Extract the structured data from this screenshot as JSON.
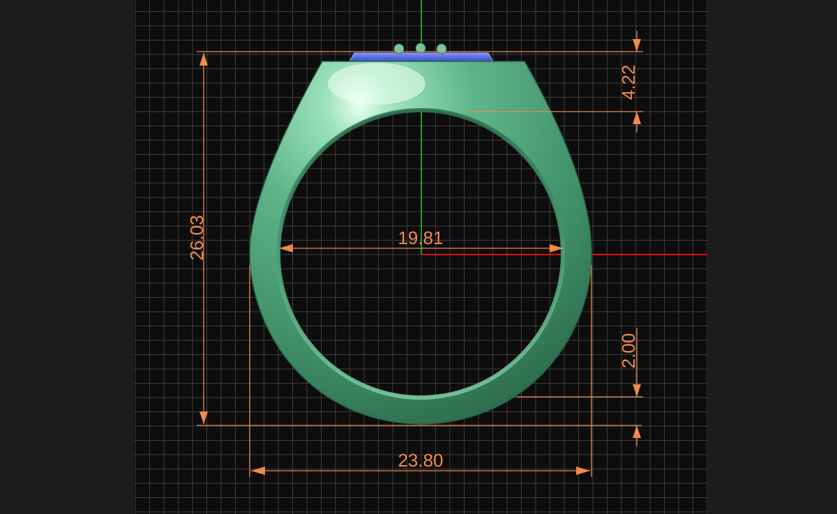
{
  "view": {
    "background": "#1c1c1c",
    "grid_background": "#0d0d0d",
    "grid_color": "#3e3e3e",
    "dimension_color": "#f08a4b",
    "x_axis_color": "#e01010",
    "y_axis_color": "#1fa31f",
    "ring_color": "#5fb58a",
    "gem_color": "#4e66d6"
  },
  "dimensions": {
    "overall_height": "26.03",
    "inner_diameter": "19.81",
    "top_thickness": "4.22",
    "bottom_thickness": "2.00",
    "overall_width": "23.80"
  }
}
